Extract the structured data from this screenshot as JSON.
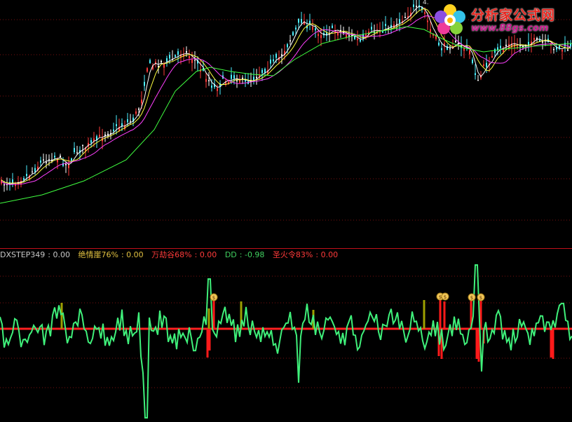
{
  "chart_data": [
    {
      "type": "line",
      "panel": "price",
      "series": [],
      "candles_direction_colors": {
        "up": "#ff3a3a",
        "down": "#4df0ff",
        "doji": "#ffffff"
      },
      "grid": "dotted-horizontal",
      "label_top": "4."
    },
    {
      "type": "line",
      "panel": "indicator",
      "title": "DXSTEP349",
      "legend": [
        {
          "name": "DXSTEP349",
          "value": "0.00",
          "color": "#c8c8c8"
        },
        {
          "name": "绝情崖76%",
          "value": "0.00",
          "color": "#e0c040"
        },
        {
          "name": "万劫谷68%",
          "value": "0.00",
          "color": "#ff3a3a"
        },
        {
          "name": "DD",
          "value": "-0.98",
          "color": "#40d060"
        },
        {
          "name": "圣火令83%",
          "value": "0.00",
          "color": "#ff3a3a"
        }
      ],
      "baseline": 0,
      "markers": [
        "money-bag",
        "money-bag",
        "money-bag",
        "money-bag",
        "money-bag"
      ]
    }
  ],
  "logo": {
    "text": "分析家公式网",
    "url": "www.88gs.com"
  },
  "colors": {
    "up": "#ff3a3a",
    "down": "#4df0ff",
    "ma_short": "#ffffff",
    "ma_mid": "#ffff40",
    "ma_long": "#ff40ff",
    "ma_slow": "#40ff40",
    "dd_line": "#3ff07a",
    "baseline": "#ff2020",
    "separator": "#c0101a"
  }
}
